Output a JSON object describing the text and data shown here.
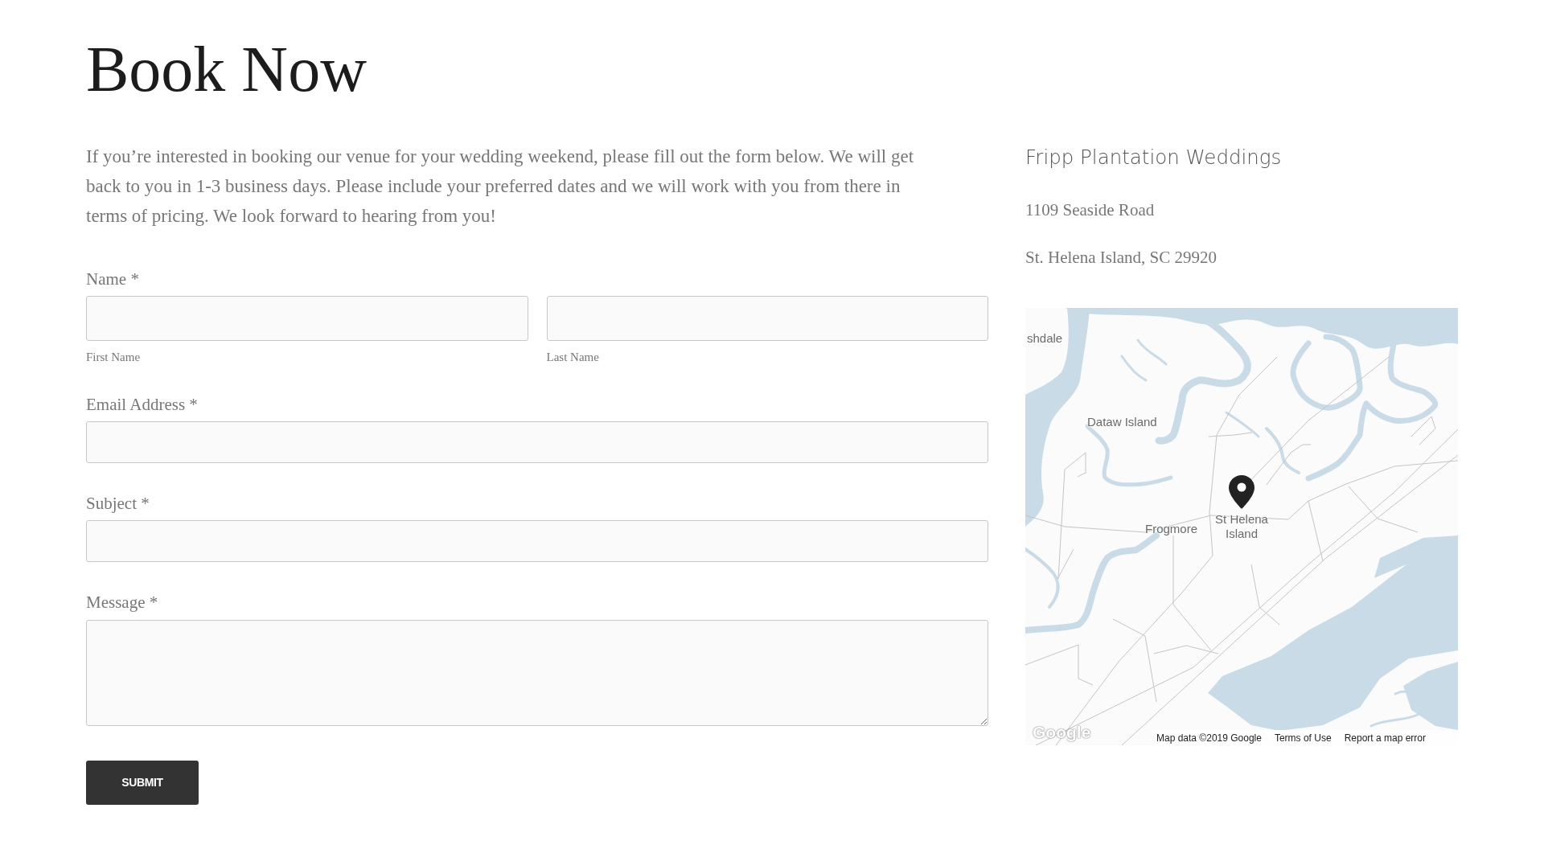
{
  "page": {
    "title": "Book Now",
    "intro": "If you’re interested in booking our venue for your wedding weekend, please fill out the form below. We will get back to you in 1-3 business days. Please include your preferred dates and we will work with you from there in terms of pricing. We look forward to hearing from you!"
  },
  "form": {
    "fields": [
      {
        "kind": "name",
        "label": "Name *",
        "parts": [
          {
            "sublabel": "First Name"
          },
          {
            "sublabel": "Last Name"
          }
        ]
      },
      {
        "kind": "text",
        "label": "Email Address *"
      },
      {
        "kind": "text",
        "label": "Subject *"
      },
      {
        "kind": "textarea",
        "label": "Message *"
      }
    ],
    "submit": "SUBMIT"
  },
  "venue": {
    "name": "Fripp Plantation Weddings",
    "address_lines": [
      "1109 Seaside Road",
      "St. Helena Island, SC 29920"
    ]
  },
  "map": {
    "labels": [
      {
        "text": "shdale"
      },
      {
        "text": "Dataw Island"
      },
      {
        "text": "Frogmore"
      },
      {
        "text": "St Helena Island"
      }
    ],
    "logo": "Google",
    "attribution": "Map data ©2019 Google",
    "links": [
      "Terms of Use",
      "Report a map error"
    ]
  }
}
